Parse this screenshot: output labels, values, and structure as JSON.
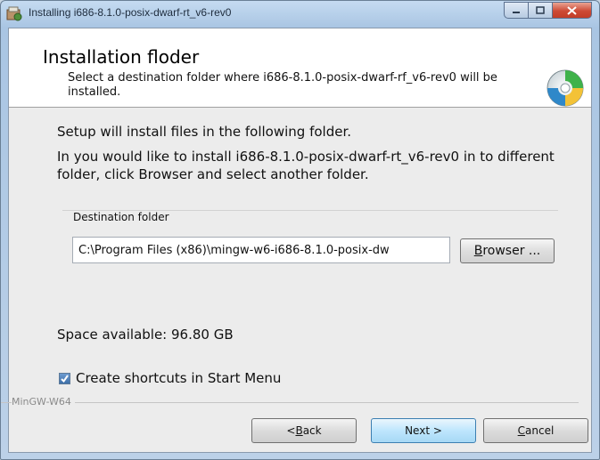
{
  "window": {
    "title": "Installing i686-8.1.0-posix-dwarf-rt_v6-rev0"
  },
  "header": {
    "title": "Installation floder",
    "description": "Select a destination folder where i686-8.1.0-posix-dwarf-rf_v6-rev0 will be installed."
  },
  "body": {
    "intro": "Setup will install files in the following folder.",
    "instructions": "In you would like to install i686-8.1.0-posix-dwarf-rt_v6-rev0 in to different folder, click Browser and select another folder."
  },
  "destination": {
    "group_label": "Destination folder",
    "path_value": "C:\\Program Files (x86)\\mingw-w6-i686-8.1.0-posix-dw",
    "browse_label_accel": "B",
    "browse_label_rest": "rowser ..."
  },
  "space_available": "Space available: 96.80 GB",
  "shortcuts": {
    "label": "Create shortcuts in Start Menu",
    "checked": true
  },
  "brand": "MinGW-W64",
  "buttons": {
    "back_prefix": "< ",
    "back_accel": "B",
    "back_rest": "ack",
    "next_label": "Next >",
    "cancel_accel": "C",
    "cancel_rest": "ancel"
  },
  "colors": {
    "title_close": "#c23d28",
    "accent_blue": "#3e6fa8"
  },
  "icons": {
    "title": "installer-icon",
    "header": "cd-disc-icon",
    "check": "checkmark-icon"
  }
}
